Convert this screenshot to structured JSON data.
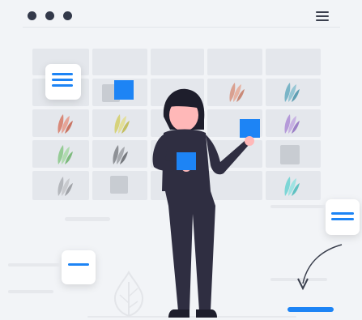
{
  "window": {
    "controls": [
      "dot",
      "dot",
      "dot"
    ],
    "menu_icon": "hamburger-icon"
  },
  "calendar": {
    "rows": 5,
    "cols": 5
  },
  "leaf_colors": [
    "#d9a090",
    "#d98a7a",
    "#d6d27a",
    "#7ab5c7",
    "#b59ad9",
    "#96cc96",
    "#b5b8bd",
    "#7cd6d6"
  ],
  "accent": "#1d84f5",
  "figure": {
    "skin": "#ffb8b8",
    "hair": "#1e1e2c",
    "clothes": "#2f2e41"
  }
}
